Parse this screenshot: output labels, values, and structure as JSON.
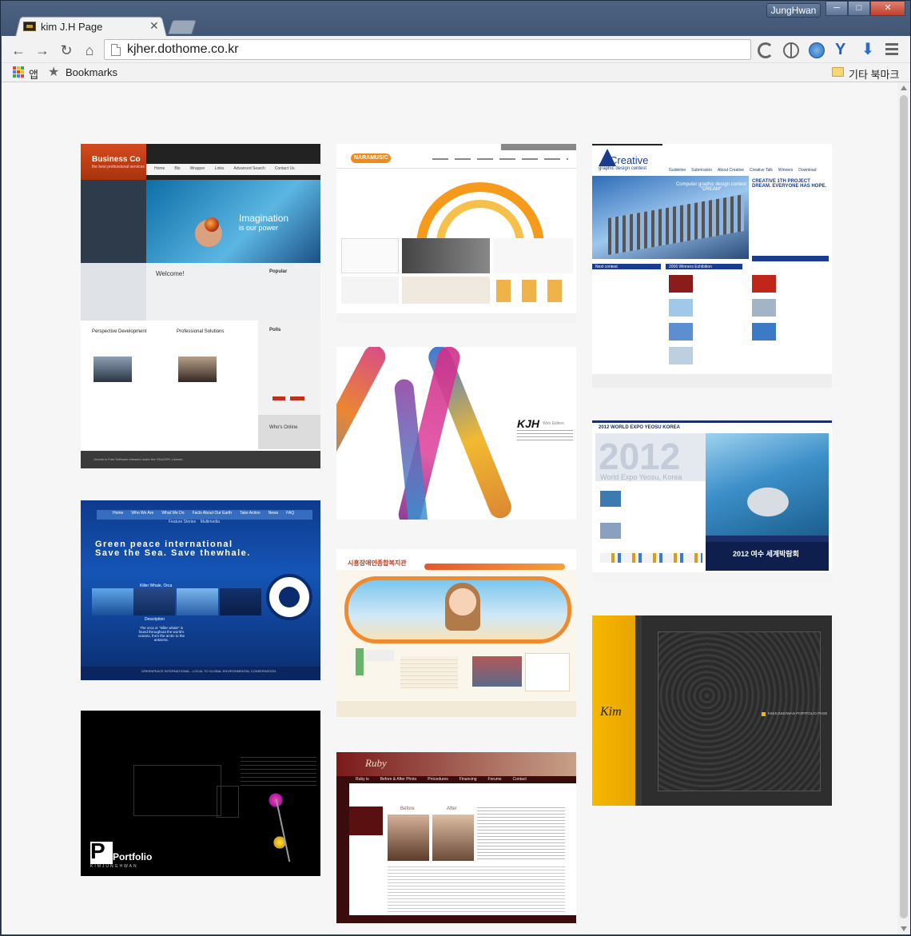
{
  "window": {
    "tab_title": "kim J.H Page",
    "tab_close": "✕",
    "user_name": "JungHwan",
    "minimize": "─",
    "maximize": "□",
    "close": "✕"
  },
  "toolbar": {
    "back": "←",
    "forward": "→",
    "reload": "↻",
    "home": "⌂",
    "url": "kjher.dothome.co.kr"
  },
  "bookmarks": {
    "apps_label": "앱",
    "bookmarks_label": "Bookmarks",
    "other_label": "기타 북마크"
  },
  "thumbnails": {
    "business": {
      "logo": "Business Co",
      "tagline": "the best professional services",
      "nav": [
        "Home",
        "Blo",
        "Wrapper",
        "Links",
        "Advanced Search",
        "Contact Us"
      ],
      "hero_title": "Imagination",
      "hero_sub": "is our power",
      "welcome": "Welcome!",
      "popular": "Popular",
      "col1": "Perspective Development",
      "col2": "Professional Solutions",
      "polls": "Polls",
      "online": "Who's Online",
      "footer": "Joomla is Free Software released under the GNU/GPL License."
    },
    "naramusic": {
      "logo": "NARAMUSIC"
    },
    "creative": {
      "logo": "Creative",
      "sub": "graphic design contest",
      "nav": [
        "Guideline",
        "Submission",
        "About Creative",
        "Creative Talk",
        "Winners",
        "Download"
      ],
      "headline": "CREATIVE 1TH PROJECT DREAM. EVERYONE HAS HOPE.",
      "hero": "Computer graphic design contest \"DREAM\"",
      "next": "Next contest",
      "exhibit": "2006 Winners Exhibition"
    },
    "kjh": {
      "title": "KJH",
      "sub": "Web Edition"
    },
    "expo": {
      "title": "2012 WORLD EXPO YEOSU KOREA",
      "big": "2012",
      "sub": "World Expo Yeosu, Korea",
      "banner": "2012 여수 세계박람회"
    },
    "greenpeace": {
      "nav": [
        "Home",
        "Who We Are",
        "What We Do",
        "Facts About Our Earth",
        "Take Action",
        "News",
        "FAQ"
      ],
      "sub_nav": "Feature Stories    Multimedia",
      "headline1": "Green peace international",
      "headline2": "Save the Sea. Save thewhale.",
      "caption": "Killer Whale, Orca",
      "desc_title": "Description",
      "desc": "The orca or \"killer whale\" is found throughout the world's oceans, from the arctic to the antarctic.",
      "footer": "GREENPEACE INTERNATIONAL - LOCAL TO GLOBAL ENVIRONMENTAL CONSERVATION"
    },
    "welfare": {
      "title": "시흥장애인종합복지관"
    },
    "portfolio_dark": {
      "title": "Portfolio",
      "sub": "KIMJUNGHWAN"
    },
    "ruby": {
      "logo": "Ruby",
      "nav": [
        "Ruby is",
        "Before & After Photo",
        "Procedures",
        "Financing",
        "Forums",
        "Contact"
      ],
      "before": "Before",
      "after": "After"
    },
    "yellow_portfolio": {
      "sign": "Kim",
      "caption": "KIMJUNGHWAN PORTFOLIO PAGE"
    }
  },
  "colors": {
    "frame": "#3d5270",
    "toolbar": "#f2f2f2",
    "viewport": "#f6f6f6"
  }
}
